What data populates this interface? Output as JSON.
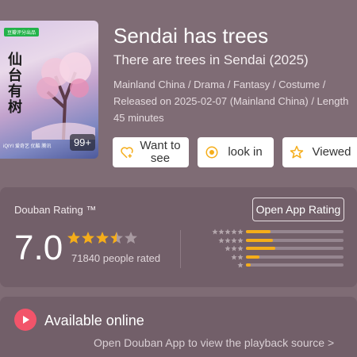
{
  "poster": {
    "badge": "豆瓣评分出品",
    "calligraphy": "仙台有树",
    "logos": "iQIYI 爱奇艺  优酷  腾讯",
    "count": "99+"
  },
  "movie": {
    "title": "Sendai has trees",
    "subtitle": "There are trees in Sendai (2025)",
    "meta_line1": "Mainland China / Drama / Fantasy / Costume /",
    "meta_line2": "Released on 2025-02-07 (Mainland China) / Length",
    "meta_line3": "45 minutes"
  },
  "actions": {
    "want_to_see": "Want to see",
    "look_in": "look in",
    "viewed": "Viewed"
  },
  "rating": {
    "label": "Douban Rating ™",
    "open_app": "Open App Rating",
    "score": "7.0",
    "stars_filled": 3.5,
    "people": "71840 people rated",
    "distribution": [
      {
        "stars": 5,
        "fraction": 0.25
      },
      {
        "stars": 4,
        "fraction": 0.28
      },
      {
        "stars": 3,
        "fraction": 0.3
      },
      {
        "stars": 2,
        "fraction": 0.14
      },
      {
        "stars": 1,
        "fraction": 0.05
      }
    ],
    "star_color": "#f5ad1a"
  },
  "online": {
    "label": "Available online",
    "link": "Open Douban App to view the playback source >",
    "play_color": "#f2546a"
  }
}
